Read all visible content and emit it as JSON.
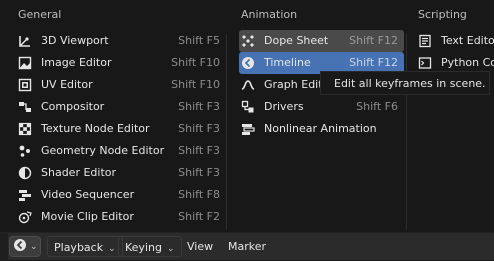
{
  "menu": {
    "general": {
      "header": "General",
      "items": [
        {
          "label": "3D Viewport",
          "shortcut": "Shift F5",
          "icon": "viewport-3d-icon"
        },
        {
          "label": "Image Editor",
          "shortcut": "Shift F10",
          "icon": "image-icon"
        },
        {
          "label": "UV Editor",
          "shortcut": "Shift F10",
          "icon": "uv-icon"
        },
        {
          "label": "Compositor",
          "shortcut": "Shift F3",
          "icon": "compositor-icon"
        },
        {
          "label": "Texture Node Editor",
          "shortcut": "Shift F3",
          "icon": "texture-icon"
        },
        {
          "label": "Geometry Node Editor",
          "shortcut": "Shift F3",
          "icon": "geometry-nodes-icon"
        },
        {
          "label": "Shader Editor",
          "shortcut": "Shift F3",
          "icon": "shader-icon"
        },
        {
          "label": "Video Sequencer",
          "shortcut": "Shift F8",
          "icon": "sequencer-icon"
        },
        {
          "label": "Movie Clip Editor",
          "shortcut": "Shift F2",
          "icon": "movie-clip-icon"
        }
      ]
    },
    "animation": {
      "header": "Animation",
      "items": [
        {
          "label": "Dope Sheet",
          "shortcut": "Shift F12",
          "icon": "dopesheet-icon"
        },
        {
          "label": "Timeline",
          "shortcut": "Shift F12",
          "icon": "timeline-icon"
        },
        {
          "label": "Graph Edit",
          "shortcut": "",
          "icon": "graph-icon"
        },
        {
          "label": "Drivers",
          "shortcut": "Shift F6",
          "icon": "drivers-icon"
        },
        {
          "label": "Nonlinear Animation",
          "shortcut": "",
          "icon": "nla-icon"
        }
      ]
    },
    "scripting": {
      "header": "Scripting",
      "items": [
        {
          "label": "Text Editor",
          "icon": "text-editor-icon"
        },
        {
          "label": "Python Co",
          "icon": "python-console-icon"
        }
      ]
    }
  },
  "tooltip": {
    "text": "Edit all keyframes in scene."
  },
  "bottom_bar": {
    "playback": "Playback",
    "keying": "Keying",
    "view": "View",
    "marker": "Marker"
  },
  "colors": {
    "highlight_blue": "#4772b3",
    "highlight_grey": "#4a4a4a",
    "background": "#181818"
  }
}
